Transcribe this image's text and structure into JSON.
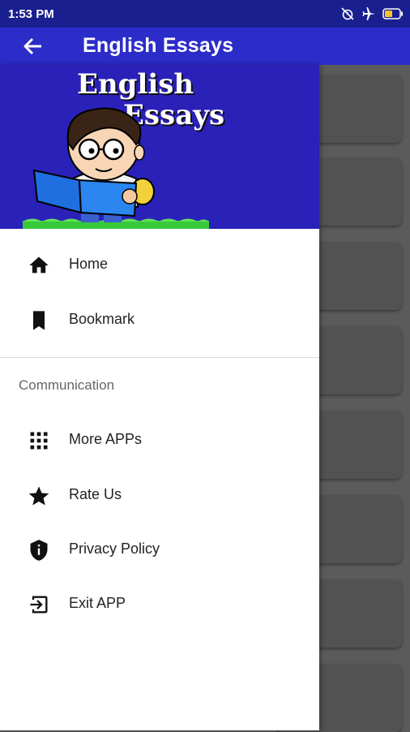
{
  "status_bar": {
    "time": "1:53 PM",
    "icons": [
      "alarm-off-icon",
      "airplane-mode-icon",
      "battery-charging-icon"
    ],
    "battery_label": "40"
  },
  "app_bar": {
    "title": "English Essays",
    "background_color": "#2c2cc9"
  },
  "drawer": {
    "header": {
      "title_line1": "English",
      "title_line2": "Essays",
      "background_color": "#2a21b9"
    },
    "items": [
      {
        "label": "Home",
        "icon": "home-icon"
      },
      {
        "label": "Bookmark",
        "icon": "bookmark-icon"
      }
    ],
    "section_title": "Communication",
    "section_items": [
      {
        "label": "More APPs",
        "icon": "apps-grid-icon"
      },
      {
        "label": "Rate Us",
        "icon": "star-icon"
      },
      {
        "label": "Privacy Policy",
        "icon": "shield-icon"
      },
      {
        "label": "Exit APP",
        "icon": "exit-icon"
      }
    ]
  }
}
